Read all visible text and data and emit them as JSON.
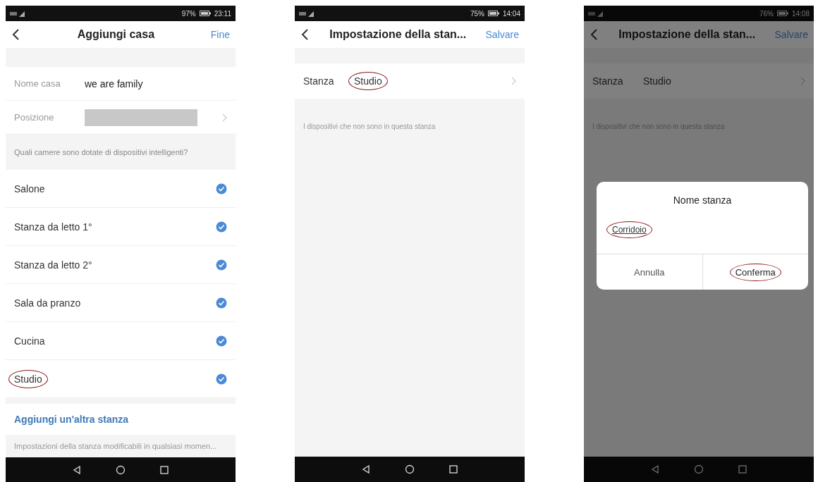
{
  "screens": [
    {
      "kind": "add_home",
      "status": {
        "battery": "97%",
        "time": "23:11"
      },
      "title": "Aggiungi casa",
      "action": "Fine",
      "fields": [
        {
          "label": "Nome casa",
          "value": "we are family",
          "redacted": false
        },
        {
          "label": "Posizione",
          "redacted": true
        }
      ],
      "section_label": "Quali camere sono dotate di dispositivi intelligenti?",
      "rooms": [
        {
          "name": "Salone",
          "checked": true,
          "circled": false
        },
        {
          "name": "Stanza da letto 1°",
          "checked": true,
          "circled": false
        },
        {
          "name": "Stanza da letto 2°",
          "checked": true,
          "circled": false
        },
        {
          "name": "Sala da pranzo",
          "checked": true,
          "circled": false
        },
        {
          "name": "Cucina",
          "checked": true,
          "circled": false
        },
        {
          "name": "Studio",
          "checked": true,
          "circled": true
        }
      ],
      "add_link": "Aggiungi un'altra stanza",
      "footer": "Impostazioni della stanza modificabili in qualsiasi momen..."
    },
    {
      "kind": "room_settings",
      "dimmed": false,
      "status": {
        "battery": "75%",
        "time": "14:04"
      },
      "title": "Impostazione della stan...",
      "action": "Salvare",
      "room": {
        "label": "Stanza",
        "value": "Studio",
        "circled": true
      },
      "note": "I dispositivi che non sono in questa stanza"
    },
    {
      "kind": "room_settings",
      "dimmed": true,
      "status": {
        "battery": "76%",
        "time": "14:08"
      },
      "title": "Impostazione della stan...",
      "action": "Salvare",
      "room": {
        "label": "Stanza",
        "value": "Studio",
        "circled": false
      },
      "note": "I dispositivi che non sono in questa stanza",
      "dialog": {
        "title": "Nome stanza",
        "input": {
          "value": "Corridoio",
          "circled": true
        },
        "buttons": [
          {
            "label": "Annulla",
            "circled": false
          },
          {
            "label": "Conferma",
            "circled": true
          }
        ]
      }
    }
  ]
}
